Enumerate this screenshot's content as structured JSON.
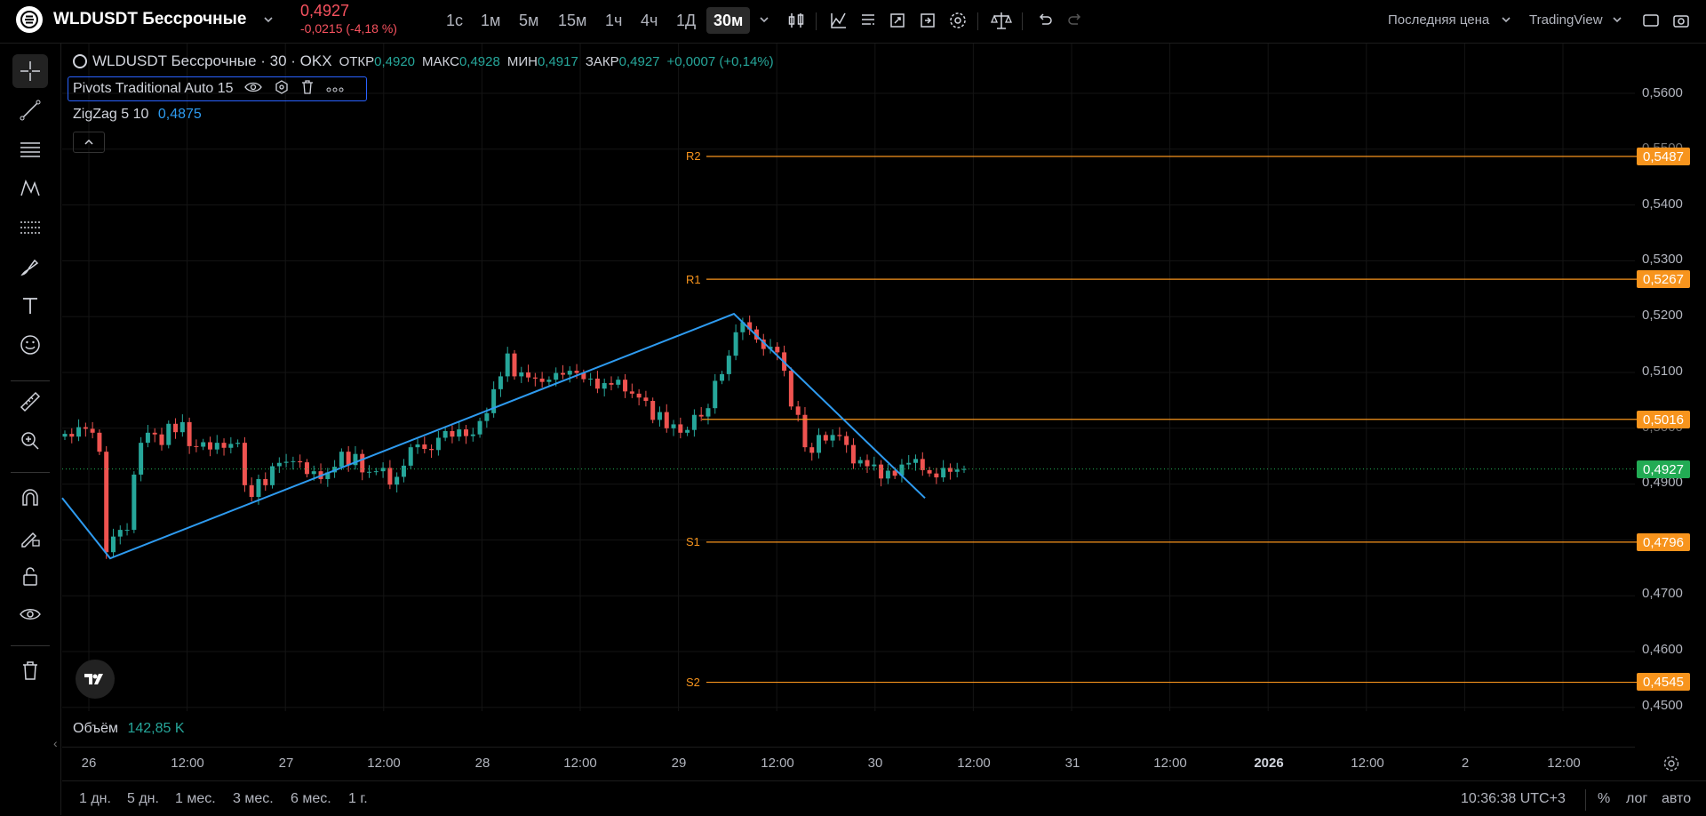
{
  "header": {
    "symbol": "WLDUSDT Бессрочные",
    "price": "0,4927",
    "change": "-0,0215 (-4,18 %)",
    "intervals": [
      "1с",
      "1м",
      "5м",
      "15м",
      "1ч",
      "4ч",
      "1Д",
      "30м"
    ],
    "active_interval": "30м",
    "price_type": "Последняя цена",
    "source": "TradingView"
  },
  "legend": {
    "title": "WLDUSDT Бессрочные · 30 · OKX",
    "open_label": "ОТКР",
    "open": "0,4920",
    "high_label": "МАКС",
    "high": "0,4928",
    "low_label": "МИН",
    "low": "0,4917",
    "close_label": "ЗАКР",
    "close": "0,4927",
    "delta": "+0,0007 (+0,14%)"
  },
  "indicators": {
    "pivots": "Pivots Traditional Auto 15",
    "zigzag_label": "ZigZag 5 10",
    "zigzag_value": "0,4875"
  },
  "volume": {
    "label": "Объём",
    "value": "142,85 K"
  },
  "price_axis": {
    "ticks": [
      "0,5600",
      "0,5500",
      "0,5400",
      "0,5300",
      "0,5200",
      "0,5100",
      "0,5000",
      "0,4900",
      "0,4700",
      "0,4600",
      "0,4500"
    ],
    "current": "0,4927",
    "current_color": "#22ab54",
    "pivot_color": "#f7941d"
  },
  "pivots": [
    {
      "label": "R2",
      "value": "0,5487"
    },
    {
      "label": "R1",
      "value": "0,5267"
    },
    {
      "label": "P",
      "value": "0,5016"
    },
    {
      "label": "S1",
      "value": "0,4796"
    },
    {
      "label": "S2",
      "value": "0,4545"
    }
  ],
  "time_axis": [
    "26",
    "12:00",
    "27",
    "12:00",
    "28",
    "12:00",
    "29",
    "12:00",
    "30",
    "12:00",
    "31",
    "12:00",
    "2026",
    "12:00",
    "2",
    "12:00"
  ],
  "ranges": [
    "1 дн.",
    "5 дн.",
    "1 мес.",
    "3 мес.",
    "6 мес.",
    "1 г."
  ],
  "footer": {
    "clock": "10:36:38 UTC+3",
    "percent": "%",
    "log": "лог",
    "auto": "авто"
  },
  "chart_data": {
    "type": "line",
    "title": "WLDUSDT Бессрочные · 30 · OKX",
    "series": [
      {
        "name": "ZigZag 5 10",
        "x": [
          "26 00:00",
          "26 08:00",
          "29 13:00",
          "30 15:30"
        ],
        "values": [
          0.4875,
          0.4767,
          0.5205,
          0.4875
        ]
      }
    ],
    "pivot_levels": {
      "R2": 0.5487,
      "R1": 0.5267,
      "P": 0.5016,
      "S1": 0.4796,
      "S2": 0.4545
    },
    "close_series": [
      0.499,
      0.4985,
      0.5002,
      0.4999,
      0.4992,
      0.4958,
      0.4778,
      0.4806,
      0.4818,
      0.4818,
      0.4917,
      0.4974,
      0.4992,
      0.4989,
      0.497,
      0.5008,
      0.4993,
      0.5011,
      0.4968,
      0.4967,
      0.4975,
      0.4962,
      0.4974,
      0.4965,
      0.4972,
      0.4974,
      0.4898,
      0.4877,
      0.4909,
      0.4898,
      0.4932,
      0.4938,
      0.494,
      0.4941,
      0.4939,
      0.4918,
      0.4923,
      0.4909,
      0.4921,
      0.4931,
      0.4958,
      0.4934,
      0.4954,
      0.4921,
      0.4922,
      0.4923,
      0.4929,
      0.4899,
      0.4913,
      0.4933,
      0.4966,
      0.4971,
      0.4963,
      0.4961,
      0.4983,
      0.4995,
      0.4985,
      0.4998,
      0.4986,
      0.4989,
      0.5013,
      0.5027,
      0.507,
      0.5093,
      0.5134,
      0.5093,
      0.51,
      0.5091,
      0.5089,
      0.5083,
      0.5087,
      0.5099,
      0.5096,
      0.5103,
      0.5099,
      0.5088,
      0.5089,
      0.5071,
      0.5081,
      0.5078,
      0.5087,
      0.5066,
      0.5062,
      0.5055,
      0.5049,
      0.5015,
      0.5029,
      0.5,
      0.5007,
      0.4992,
      0.4997,
      0.5024,
      0.5021,
      0.5036,
      0.5085,
      0.5097,
      0.513,
      0.5172,
      0.519,
      0.5177,
      0.5159,
      0.5142,
      0.5146,
      0.5136,
      0.5103,
      0.5039,
      0.5024,
      0.4966,
      0.4956,
      0.4988,
      0.4978,
      0.4988,
      0.4986,
      0.497,
      0.4937,
      0.4943,
      0.4932,
      0.4935,
      0.491,
      0.4924,
      0.4915,
      0.4935,
      0.4938,
      0.4945,
      0.4925,
      0.4919,
      0.4912,
      0.4929,
      0.4922,
      0.4926,
      0.4927
    ],
    "x_ticks": [
      "26",
      "12:00",
      "27",
      "12:00",
      "28",
      "12:00",
      "29",
      "12:00",
      "30",
      "12:00",
      "31",
      "12:00",
      "2026",
      "12:00",
      "2",
      "12:00"
    ],
    "ylim": [
      0.445,
      0.565
    ],
    "grid": true
  }
}
